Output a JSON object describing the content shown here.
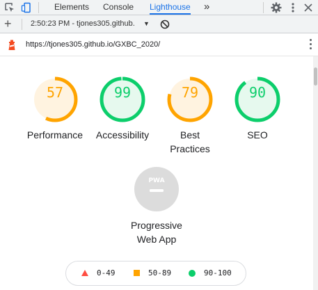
{
  "tabbar": {
    "tabs": [
      "Elements",
      "Console",
      "Lighthouse"
    ],
    "active_tab": "Lighthouse",
    "overflow_label": "»"
  },
  "toolbar": {
    "new_report_label": "+",
    "report_selector": "2:50:23 PM - tjones305.github."
  },
  "urlbar": {
    "url": "https://tjones305.github.io/GXBC_2020/"
  },
  "scores": [
    {
      "name": "Performance",
      "label_line1": "Performance",
      "label_line2": "",
      "score": 57,
      "color": "#ffa400",
      "bg": "#fff3e0"
    },
    {
      "name": "Accessibility",
      "label_line1": "Accessibility",
      "label_line2": "",
      "score": 99,
      "color": "#0cce6b",
      "bg": "#e6f9ee"
    },
    {
      "name": "Best Practices",
      "label_line1": "Best",
      "label_line2": "Practices",
      "score": 79,
      "color": "#ffa400",
      "bg": "#fff3e0"
    },
    {
      "name": "SEO",
      "label_line1": "SEO",
      "label_line2": "",
      "score": 90,
      "color": "#0cce6b",
      "bg": "#e6f9ee"
    }
  ],
  "pwa": {
    "badge_text": "PWA",
    "label_line1": "Progressive",
    "label_line2": "Web App"
  },
  "legend": [
    {
      "range": "0-49",
      "shape": "triangle",
      "color": "#ff4e42"
    },
    {
      "range": "50-89",
      "shape": "square",
      "color": "#ffa400"
    },
    {
      "range": "90-100",
      "shape": "circle",
      "color": "#0cce6b"
    }
  ]
}
